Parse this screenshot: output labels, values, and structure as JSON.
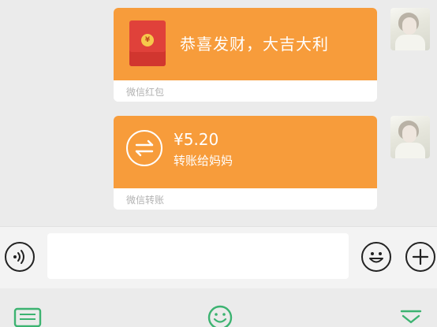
{
  "messages": [
    {
      "type": "red-packet",
      "greeting": "恭喜发财，大吉大利",
      "caption": "微信红包",
      "seal_char": "¥"
    },
    {
      "type": "transfer",
      "amount": "¥5.20",
      "description": "转账给妈妈",
      "caption": "微信转账"
    }
  ],
  "colors": {
    "bubble_orange": "#f79c3b",
    "red_packet": "#e0413a",
    "accent_green": "#3cb371"
  },
  "icons": {
    "voice": "voice-icon",
    "emoji": "emoji-icon",
    "plus": "plus-icon",
    "keyboard": "keyboard-icon",
    "sticker": "smiley-icon",
    "collapse": "chevron-down-icon"
  }
}
